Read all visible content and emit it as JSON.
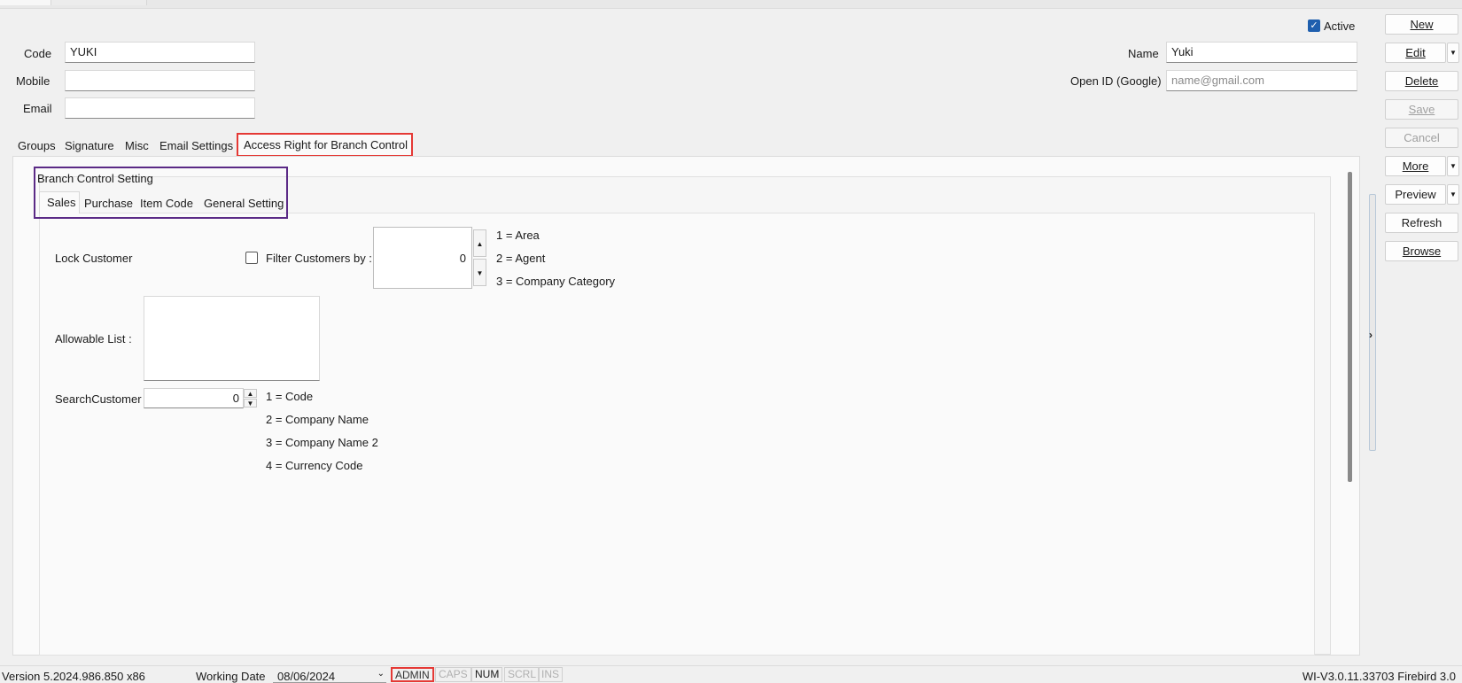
{
  "header": {
    "active_label": "Active",
    "active_checked": true,
    "code_label": "Code",
    "code_value": "YUKI",
    "mobile_label": "Mobile",
    "mobile_value": "",
    "email_label": "Email",
    "email_value": "",
    "name_label": "Name",
    "name_value": "Yuki",
    "openid_label": "Open ID (Google)",
    "openid_placeholder": "name@gmail.com"
  },
  "buttons": {
    "new": "New",
    "edit": "Edit",
    "delete": "Delete",
    "save": "Save",
    "cancel": "Cancel",
    "more": "More",
    "preview": "Preview",
    "refresh": "Refresh",
    "browse": "Browse"
  },
  "tabs": [
    "Groups",
    "Signature",
    "Misc",
    "Email Settings",
    "Access Right for Branch Control"
  ],
  "branch": {
    "group_title": "Branch Control Setting",
    "subtabs": [
      "Sales",
      "Purchase",
      "Item Code",
      "General Setting"
    ],
    "lock_customer_label": "Lock Customer",
    "filter_label": "Filter Customers by :",
    "filter_value": "0",
    "filter_options": [
      "1 = Area",
      "2 = Agent",
      "3 = Company Category"
    ],
    "allowable_label": "Allowable List :",
    "search_label": "SearchCustomer",
    "search_value": "0",
    "search_options": [
      "1 = Code",
      "2 = Company Name",
      "3 = Company Name 2",
      "4 = Currency Code"
    ]
  },
  "status": {
    "version": "Version 5.2024.986.850 x86",
    "working_date_label": "Working Date",
    "working_date": "08/06/2024",
    "user": "ADMIN",
    "caps": "CAPS",
    "num": "NUM",
    "scrl": "SCRL",
    "ins": "INS",
    "build": "WI-V3.0.11.33703 Firebird 3.0"
  },
  "colors": {
    "highlight_red": "#e53935",
    "highlight_purple": "#5b2a86",
    "checkbox_blue": "#1f5fae"
  }
}
